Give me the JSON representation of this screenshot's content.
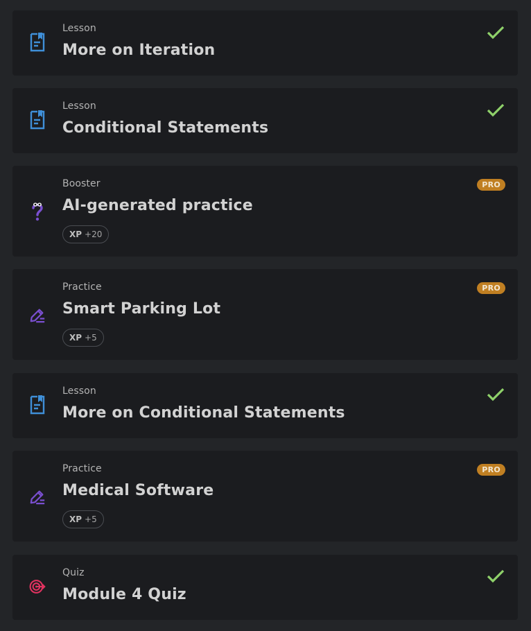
{
  "items": [
    {
      "kind": "Lesson",
      "title": "More on Iteration",
      "icon": "lesson-doc-icon",
      "status": "completed"
    },
    {
      "kind": "Lesson",
      "title": "Conditional Statements",
      "icon": "lesson-doc-icon",
      "status": "completed"
    },
    {
      "kind": "Booster",
      "title": "AI-generated practice",
      "icon": "ai-question-icon",
      "badge": "PRO",
      "xp_label": "XP",
      "xp_value": "+20"
    },
    {
      "kind": "Practice",
      "title": "Smart Parking Lot",
      "icon": "pencil-edit-icon",
      "badge": "PRO",
      "xp_label": "XP",
      "xp_value": "+5"
    },
    {
      "kind": "Lesson",
      "title": "More on Conditional Statements",
      "icon": "lesson-doc-icon",
      "status": "completed"
    },
    {
      "kind": "Practice",
      "title": "Medical Software",
      "icon": "pencil-edit-icon",
      "badge": "PRO",
      "xp_label": "XP",
      "xp_value": "+5"
    },
    {
      "kind": "Quiz",
      "title": "Module 4 Quiz",
      "icon": "target-icon",
      "status": "completed"
    }
  ],
  "colors": {
    "lesson_icon": "#3f8fd8",
    "practice_icon": "#7a4fd0",
    "quiz_icon": "#e0325f",
    "check": "#8fd16a",
    "pro_badge": "#c07f22"
  }
}
